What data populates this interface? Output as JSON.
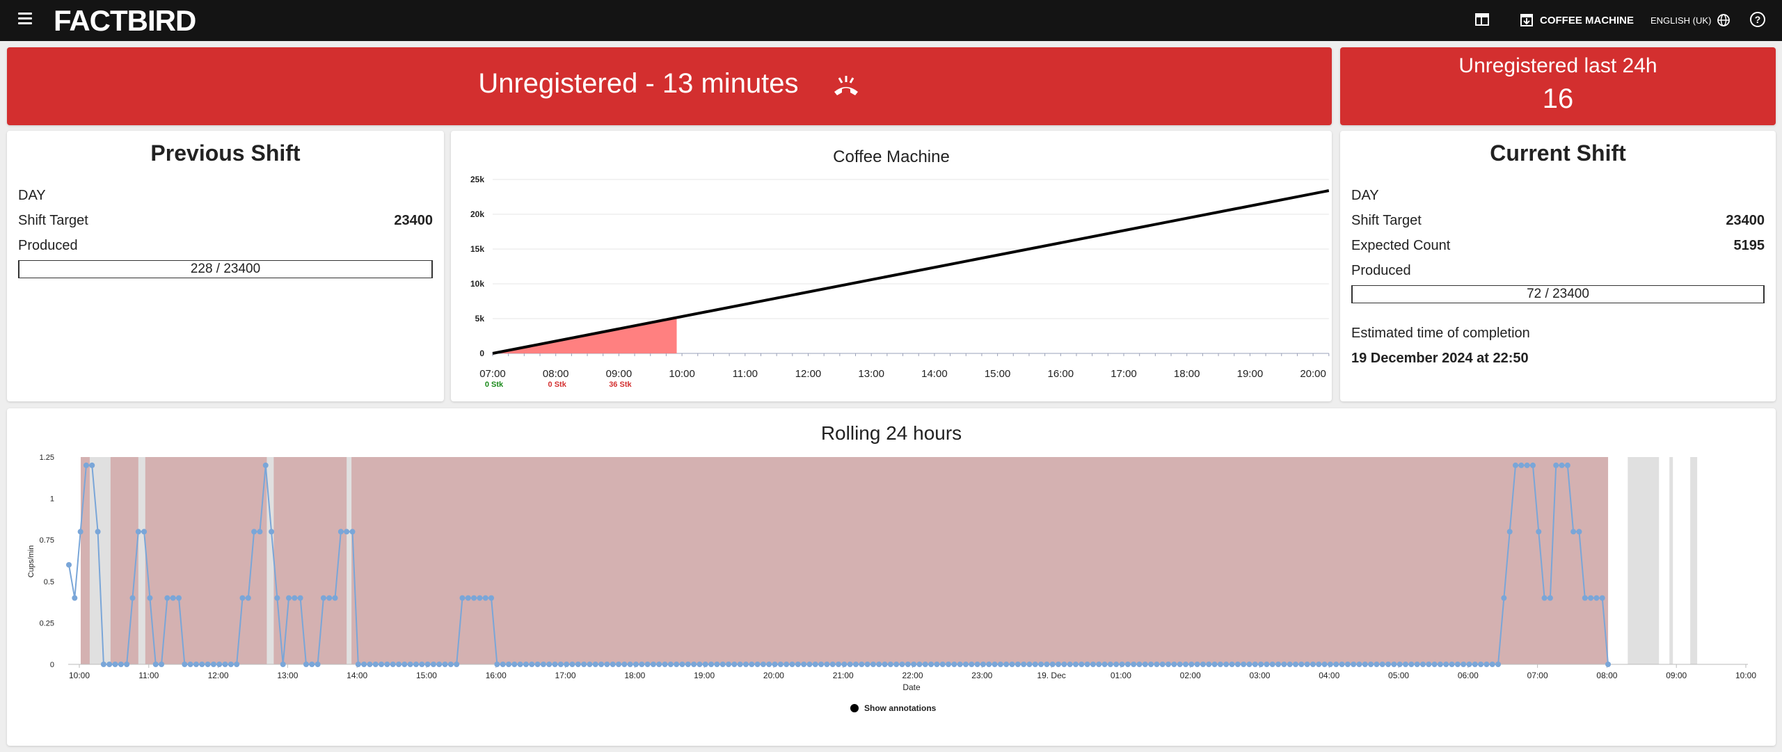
{
  "app": {
    "logo": "FACTBIRD"
  },
  "topbar": {
    "menu_icon": "menu-icon",
    "dashboard_icon": "dashboard-icon",
    "machine_label": "COFFEE MACHINE",
    "language_label": "ENGLISH (UK)",
    "help_icon": "help-icon"
  },
  "alert": {
    "status_text": "Unregistered - 13 minutes",
    "icon": "phone-hangup-icon",
    "color": "#d32f2f"
  },
  "alert_side": {
    "title": "Unregistered last 24h",
    "count": "16"
  },
  "previous_shift": {
    "title": "Previous Shift",
    "shift_name": "DAY",
    "target_label": "Shift Target",
    "target_value": "23400",
    "produced_label": "Produced",
    "produced_text": "228 / 23400",
    "produced_fraction": 0.0097
  },
  "current_shift": {
    "title": "Current Shift",
    "shift_name": "DAY",
    "target_label": "Shift Target",
    "target_value": "23400",
    "expected_label": "Expected Count",
    "expected_value": "5195",
    "produced_label": "Produced",
    "produced_text": "72 / 23400",
    "produced_fraction": 0.0031,
    "eta_label": "Estimated time of completion",
    "eta_value": "19 December 2024 at 22:50"
  },
  "chart_data": [
    {
      "type": "area",
      "title": "Coffee Machine",
      "x": [
        "07:00",
        "08:00",
        "09:00",
        "10:00",
        "11:00",
        "12:00",
        "13:00",
        "14:00",
        "15:00",
        "16:00",
        "17:00",
        "18:00",
        "19:00",
        "20:00"
      ],
      "y_ticks": [
        "0",
        "5k",
        "10k",
        "15k",
        "20k",
        "25k"
      ],
      "ylim": [
        0,
        25000
      ],
      "target_line": {
        "x_start": "07:00",
        "y_start": 0,
        "x_end": "20:15",
        "y_end": 23400,
        "color": "#000000"
      },
      "actual_area": {
        "x_start": "07:00",
        "x_end": "09:55",
        "y_end": 5195,
        "color": "#ff8080"
      },
      "hour_counts": [
        {
          "x": "07:00",
          "label": "0 Stk",
          "color": "#1a8a1a"
        },
        {
          "x": "08:00",
          "label": "0 Stk",
          "color": "#d32f2f"
        },
        {
          "x": "09:00",
          "label": "36 Stk",
          "color": "#d32f2f"
        }
      ],
      "grid": true
    },
    {
      "type": "line",
      "title": "Rolling 24 hours",
      "xlabel": "Date",
      "ylabel": "Cups/min",
      "ylim": [
        0,
        1.25
      ],
      "y_ticks": [
        "0",
        "0.25",
        "0.5",
        "0.75",
        "1",
        "1.25"
      ],
      "x_ticks": [
        "10:00",
        "11:00",
        "12:00",
        "13:00",
        "14:00",
        "15:00",
        "16:00",
        "17:00",
        "18:00",
        "19:00",
        "20:00",
        "21:00",
        "22:00",
        "23:00",
        "19. Dec",
        "01:00",
        "02:00",
        "03:00",
        "04:00",
        "05:00",
        "06:00",
        "07:00",
        "08:00",
        "09:00",
        "10:00"
      ],
      "line_color": "#7aa6d8",
      "band_color": "#d4b1b1",
      "registered_color": "#e0e0e0",
      "x_start_hours": 9.95,
      "step_minutes": 5,
      "values": [
        0.6,
        0.4,
        0.8,
        1.2,
        1.2,
        0.8,
        0,
        0,
        0,
        0,
        0,
        0.4,
        0.8,
        0.8,
        0.4,
        0,
        0,
        0.4,
        0.4,
        0.4,
        0,
        0,
        0,
        0,
        0,
        0,
        0,
        0,
        0,
        0,
        0.4,
        0.4,
        0.8,
        0.8,
        1.2,
        0.8,
        0.4,
        0,
        0.4,
        0.4,
        0.4,
        0,
        0,
        0,
        0.4,
        0.4,
        0.4,
        0.8,
        0.8,
        0.8,
        0,
        0,
        0,
        0,
        0,
        0,
        0,
        0,
        0,
        0,
        0,
        0,
        0,
        0,
        0,
        0,
        0,
        0,
        0.4,
        0.4,
        0.4,
        0.4,
        0.4,
        0.4,
        0,
        0,
        0,
        0,
        0,
        0,
        0,
        0,
        0,
        0,
        0,
        0,
        0,
        0,
        0,
        0,
        0,
        0,
        0,
        0,
        0,
        0,
        0,
        0,
        0,
        0,
        0,
        0,
        0,
        0,
        0,
        0,
        0,
        0,
        0,
        0,
        0,
        0,
        0,
        0,
        0,
        0,
        0,
        0,
        0,
        0,
        0,
        0,
        0,
        0,
        0,
        0,
        0,
        0,
        0,
        0,
        0,
        0,
        0,
        0,
        0,
        0,
        0,
        0,
        0,
        0,
        0,
        0,
        0,
        0,
        0,
        0,
        0,
        0,
        0,
        0,
        0,
        0,
        0,
        0,
        0,
        0,
        0,
        0,
        0,
        0,
        0,
        0,
        0,
        0,
        0,
        0,
        0,
        0,
        0,
        0,
        0,
        0,
        0,
        0,
        0,
        0,
        0,
        0,
        0,
        0,
        0,
        0,
        0,
        0,
        0,
        0,
        0,
        0,
        0,
        0,
        0,
        0,
        0,
        0,
        0,
        0,
        0,
        0,
        0,
        0,
        0,
        0,
        0,
        0,
        0,
        0,
        0,
        0,
        0,
        0,
        0,
        0,
        0,
        0,
        0,
        0,
        0,
        0,
        0,
        0,
        0,
        0,
        0,
        0,
        0,
        0,
        0,
        0,
        0,
        0,
        0,
        0,
        0,
        0,
        0,
        0,
        0,
        0,
        0,
        0,
        0,
        0,
        0,
        0,
        0,
        0,
        0,
        0,
        0.4,
        0.8,
        1.2,
        1.2,
        1.2,
        1.2,
        0.8,
        0.4,
        0.4,
        1.2,
        1.2,
        1.2,
        0.8,
        0.8,
        0.4,
        0.4,
        0.4,
        0.4,
        0
      ],
      "registered_periods": [
        [
          10.25,
          10.55
        ],
        [
          10.95,
          11.05
        ],
        [
          12.8,
          12.9
        ],
        [
          13.95,
          14.02
        ],
        [
          8.4,
          8.85
        ],
        [
          9.0,
          9.05
        ],
        [
          9.3,
          9.4
        ]
      ],
      "legend": "Show annotations"
    }
  ]
}
